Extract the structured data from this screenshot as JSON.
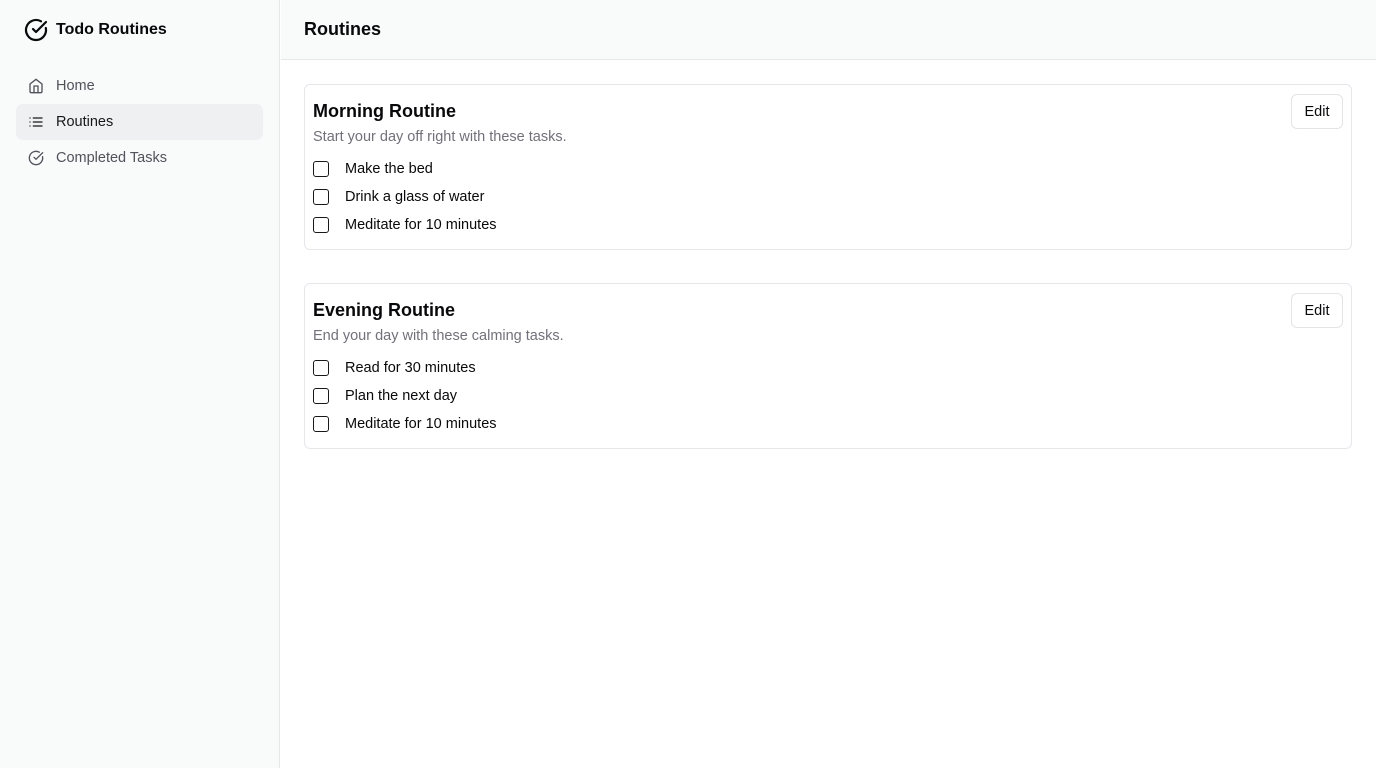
{
  "app": {
    "title": "Todo Routines",
    "icon": "check-circle-icon"
  },
  "sidebar": {
    "items": [
      {
        "label": "Home",
        "icon": "home-icon",
        "active": false
      },
      {
        "label": "Routines",
        "icon": "list-icon",
        "active": true
      },
      {
        "label": "Completed Tasks",
        "icon": "check-circle-icon",
        "active": false
      }
    ]
  },
  "header": {
    "title": "Routines"
  },
  "routines": [
    {
      "title": "Morning Routine",
      "description": "Start your day off right with these tasks.",
      "edit_label": "Edit",
      "tasks": [
        {
          "label": "Make the bed",
          "checked": false
        },
        {
          "label": "Drink a glass of water",
          "checked": false
        },
        {
          "label": "Meditate for 10 minutes",
          "checked": false
        }
      ]
    },
    {
      "title": "Evening Routine",
      "description": "End your day with these calming tasks.",
      "edit_label": "Edit",
      "tasks": [
        {
          "label": "Read for 30 minutes",
          "checked": false
        },
        {
          "label": "Plan the next day",
          "checked": false
        },
        {
          "label": "Meditate for 10 minutes",
          "checked": false
        }
      ]
    }
  ],
  "colors": {
    "sidebar_bg": "#f9fafa",
    "active_item_bg": "#eff0f2",
    "border": "#e5e7eb",
    "muted_text": "#71717a"
  }
}
